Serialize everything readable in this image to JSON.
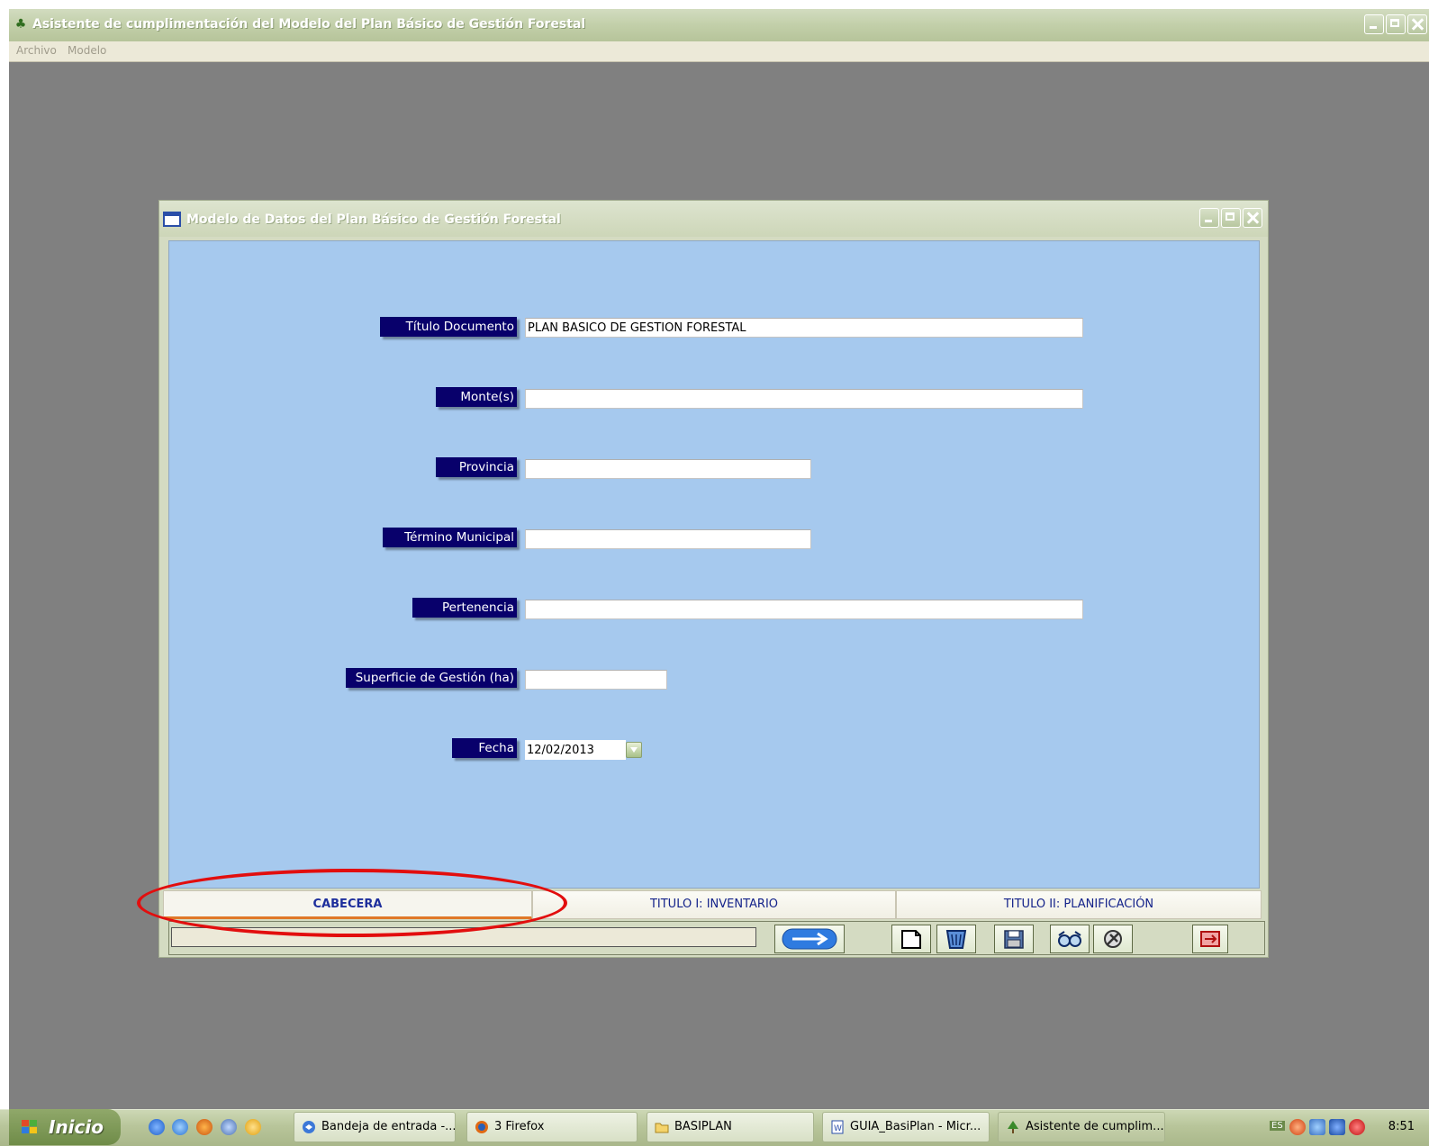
{
  "app": {
    "title": "Asistente de cumplimentación del Modelo del Plan Básico de Gestión Forestal",
    "menu": [
      "Archivo",
      "Modelo"
    ]
  },
  "child": {
    "title": "Modelo de Datos del Plan Básico de Gestión Forestal"
  },
  "form": {
    "titulo_label": "Título Documento",
    "titulo_value": "PLAN BÁSICO DE GESTIÓN FORESTAL",
    "montes_label": "Monte(s)",
    "montes_value": "",
    "provincia_label": "Provincia",
    "provincia_value": "",
    "termino_label": "Término Municipal",
    "termino_value": "",
    "pertenencia_label": "Pertenencia",
    "pertenencia_value": "",
    "superficie_label": "Superficie de Gestión (ha)",
    "superficie_value": "",
    "fecha_label": "Fecha",
    "fecha_value": "12/02/2013"
  },
  "tabs": [
    "CABECERA",
    "TITULO I: INVENTARIO",
    "TITULO II: PLANIFICACIÓN"
  ],
  "active_tab": "CABECERA",
  "toolbar": {
    "icons": [
      "next-arrow-icon",
      "new-document-icon",
      "delete-bin-icon",
      "save-disk-icon",
      "view-glasses-icon",
      "tools-icon",
      "exit-icon"
    ]
  },
  "taskbar": {
    "start_label": "Inicio",
    "items": [
      "Bandeja de entrada -...",
      "3 Firefox",
      "BASIPLAN",
      "GUIA_BasiPlan - Micr...",
      "Asistente de cumplim..."
    ],
    "lang": "ES",
    "clock": "8:51"
  },
  "colors": {
    "label_bg": "#08006b",
    "form_bg": "#a6c9ee",
    "window_frame": "#d4dbc2",
    "active_tab_accent": "#e07828",
    "annotation": "#e20e0e"
  }
}
